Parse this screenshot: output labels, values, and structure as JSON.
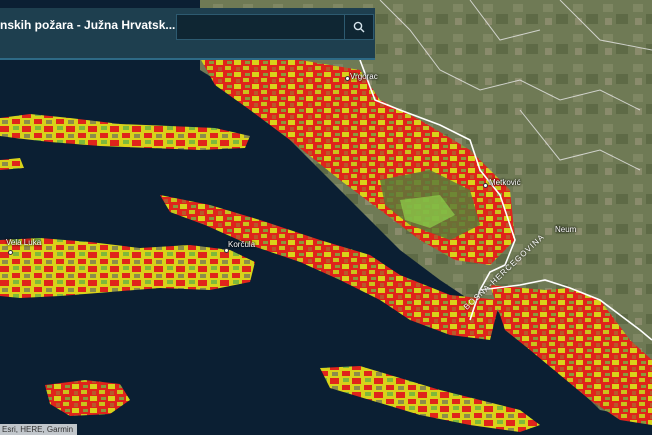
{
  "header": {
    "title": "nskih požara - Južna Hrvatsk...",
    "search": {
      "placeholder": "",
      "icon": "search-icon"
    }
  },
  "map": {
    "labels": {
      "vrgorac": "Vrgorac",
      "metkovic": "Metković",
      "neum": "Neum",
      "korcula": "Korčula",
      "vela_luka": "Vela Luka",
      "bosna": "BOSNA-HERCEGOVINA"
    },
    "colors": {
      "sea": "#0b1f33",
      "land": "#6e7a52",
      "high_risk": "#e0241b",
      "medium_risk": "#d9d21a",
      "low_risk": "#7fb83a",
      "border": "#ffffff"
    }
  },
  "attribution": "Esri, HERE, Garmin"
}
